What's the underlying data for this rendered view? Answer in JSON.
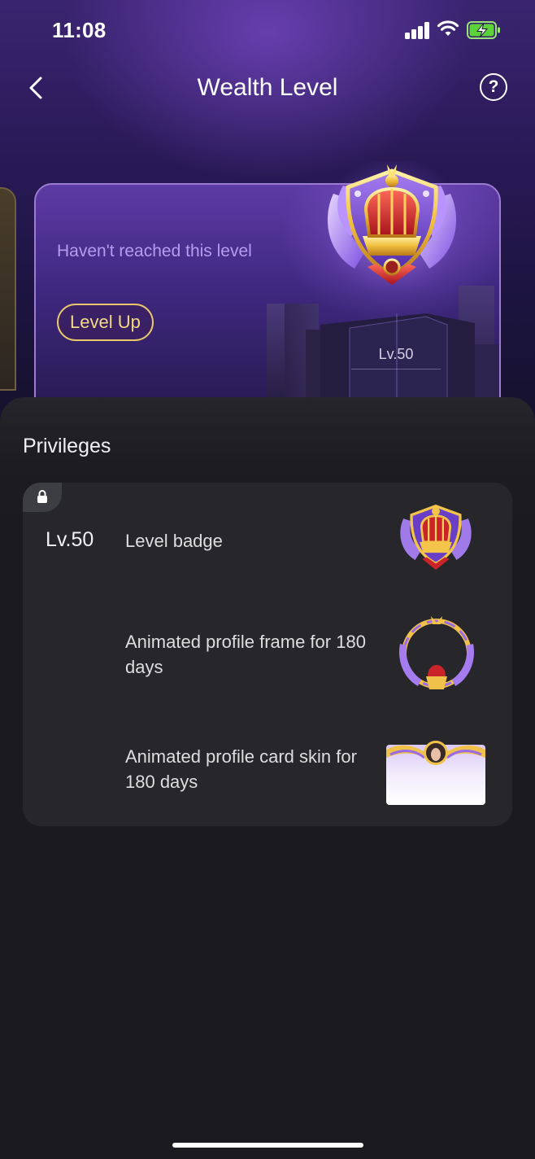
{
  "status_bar": {
    "time": "11:08"
  },
  "header": {
    "title": "Wealth Level",
    "back_icon": "chevron-left-icon",
    "help_symbol": "?"
  },
  "level_card": {
    "status": "Haven't reached this level",
    "action_label": "Level Up",
    "level_label": "Lv.50"
  },
  "privileges": {
    "title": "Privileges",
    "level": "Lv.50",
    "items": [
      {
        "label": "Level badge",
        "icon": "crown-badge-icon"
      },
      {
        "label": "Animated profile frame for 180 days",
        "icon": "profile-frame-icon"
      },
      {
        "label": "Animated profile card skin for 180 days",
        "icon": "profile-card-skin-icon"
      }
    ]
  },
  "colors": {
    "accent_purple": "#b79bf0",
    "gold": "#f4d987",
    "background": "#1b1b1f",
    "card": "#26262b"
  }
}
